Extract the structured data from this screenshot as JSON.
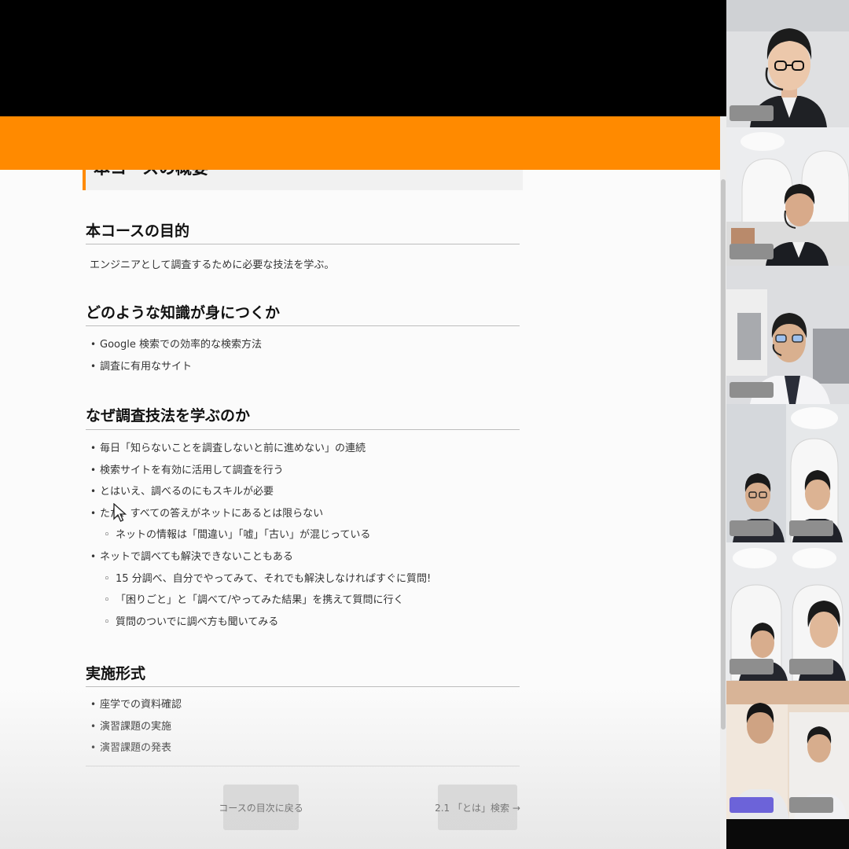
{
  "document": {
    "page_heading": "本コースの概要",
    "sections": [
      {
        "title": "本コースの目的",
        "paragraph": "エンジニアとして調査するために必要な技法を学ぶ。"
      },
      {
        "title": "どのような知識が身につくか",
        "items": [
          {
            "text": "Google 検索での効率的な検索方法",
            "level": 1
          },
          {
            "text": "調査に有用なサイト",
            "level": 1
          }
        ]
      },
      {
        "title": "なぜ調査技法を学ぶのか",
        "items": [
          {
            "text": "毎日「知らないことを調査しないと前に進めない」の連続",
            "level": 1
          },
          {
            "text": "検索サイトを有効に活用して調査を行う",
            "level": 1
          },
          {
            "text": "とはいえ、調べるのにもスキルが必要",
            "level": 1
          },
          {
            "text": "ただ、すべての答えがネットにあるとは限らない",
            "level": 1
          },
          {
            "text": "ネットの情報は「間違い」「嘘」「古い」が混じっている",
            "level": 2
          },
          {
            "text": "ネットで調べても解決できないこともある",
            "level": 1
          },
          {
            "text": "15 分調べ、自分でやってみて、それでも解決しなければすぐに質問!",
            "level": 2
          },
          {
            "text": "「困りごと」と「調べて/やってみた結果」を携えて質問に行く",
            "level": 2
          },
          {
            "text": "質問のついでに調べ方も聞いてみる",
            "level": 2
          }
        ]
      },
      {
        "title": "実施形式",
        "items": [
          {
            "text": "座学での資料確認",
            "level": 1
          },
          {
            "text": "演習課題の実施",
            "level": 1
          },
          {
            "text": "演習課題の発表",
            "level": 1
          }
        ]
      }
    ],
    "nav": {
      "prev_label": "コースの目次に戻る",
      "next_label": "2.1 「とは」検索 →"
    }
  },
  "colors": {
    "accent": "#ff8a00",
    "page_background": "#fbfbfb",
    "button_background": "#dadada"
  },
  "participants": [
    {
      "icon": "person-glasses-headset",
      "name_tag": "",
      "background": "office"
    },
    {
      "icon": "person-headset",
      "name_tag": "",
      "background": "white-arches"
    },
    {
      "icon": "person-glasses-headset",
      "name_tag": "",
      "background": "blurred-room"
    },
    {
      "icon": "two-people-glasses",
      "name_tag": "",
      "background": "white-arches"
    },
    {
      "icon": "two-people",
      "name_tag": "",
      "background": "white-arches"
    },
    {
      "icon": "two-people",
      "name_tag": "",
      "background": "wood-wall"
    }
  ]
}
